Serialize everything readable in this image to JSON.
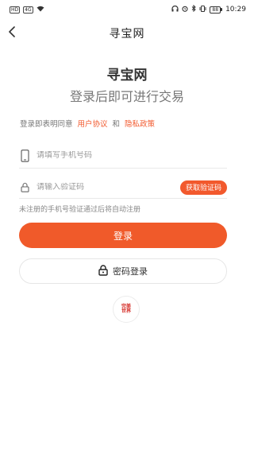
{
  "status_bar": {
    "left_chips": [
      "HD",
      "4G"
    ],
    "time": "10:29",
    "battery": "88",
    "icons": [
      "wifi-icon",
      "headphones-icon",
      "alarm-icon",
      "bluetooth-icon",
      "vibrate-icon",
      "battery-icon"
    ]
  },
  "nav": {
    "logo_text": "寻宝网",
    "back_icon": "chevron-left-icon"
  },
  "header": {
    "app_title": "寻宝网",
    "subtitle": "登录后即可进行交易"
  },
  "agreement": {
    "prefix": "登录即表明同意",
    "user_agreement": "用户协议",
    "and": "和",
    "privacy_policy": "隐私政策"
  },
  "form": {
    "phone_placeholder": "请填写手机号码",
    "code_placeholder": "请输入验证码",
    "get_code_label": "获取验证码",
    "hint": "未注册的手机号验证通过后将自动注册"
  },
  "actions": {
    "login_label": "登录",
    "password_login_label": "密码登录"
  },
  "third_party": {
    "logo_text": "完美世界",
    "logo_color": "#d42b25"
  },
  "colors": {
    "accent": "#f05a2a"
  }
}
